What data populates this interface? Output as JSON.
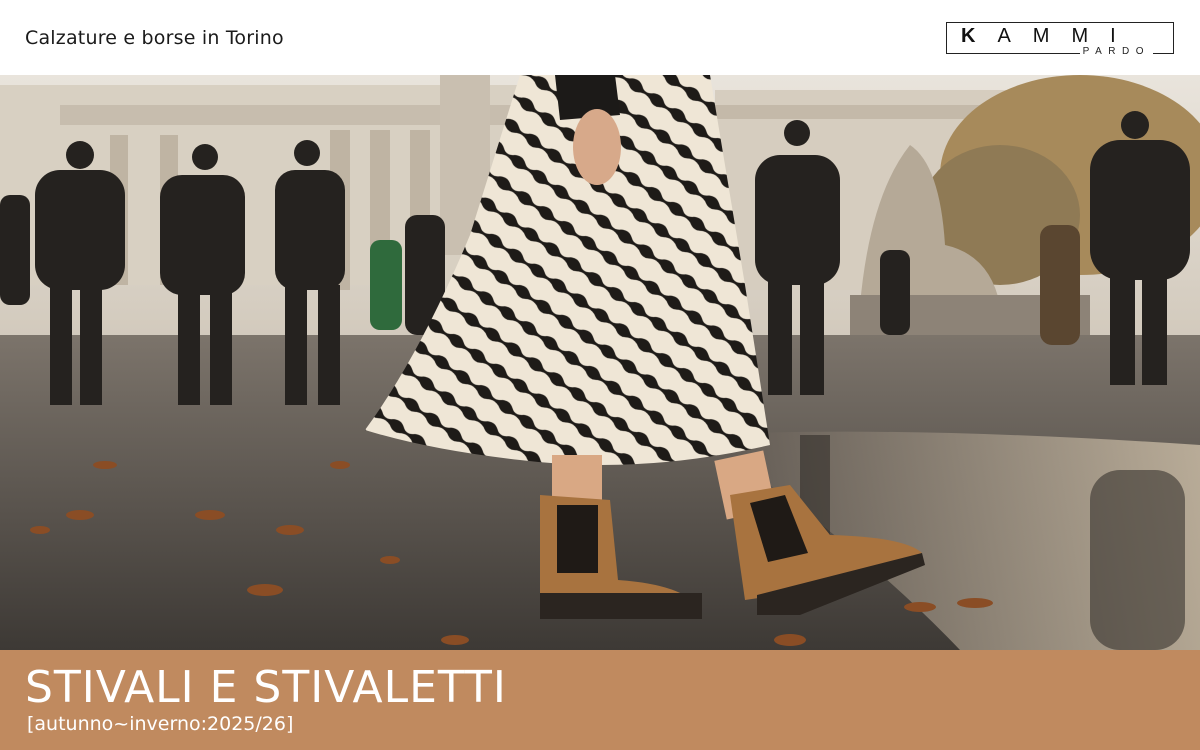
{
  "header": {
    "tagline": "Calzature e borse in Torino",
    "logo": {
      "main_initial": "K",
      "main_rest": "AMMI",
      "sub": "PARDO"
    }
  },
  "hero": {
    "scene": "street-fashion-photo"
  },
  "banner": {
    "title": "STIVALI E STIVALETTI",
    "subtitle": "[autunno~inverno:2025/26]",
    "color": "#c08a5f"
  }
}
